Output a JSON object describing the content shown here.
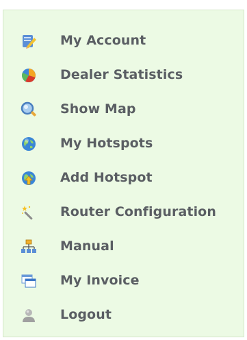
{
  "menu": {
    "items": [
      {
        "label": "My Account",
        "icon": "pencil-account-icon"
      },
      {
        "label": "Dealer Statistics",
        "icon": "pie-chart-icon"
      },
      {
        "label": "Show Map",
        "icon": "magnifier-icon"
      },
      {
        "label": "My Hotspots",
        "icon": "globe-icon"
      },
      {
        "label": "Add Hotspot",
        "icon": "globe-add-icon"
      },
      {
        "label": "Router Configuration",
        "icon": "magic-wand-icon"
      },
      {
        "label": "Manual",
        "icon": "sitemap-icon"
      },
      {
        "label": "My Invoice",
        "icon": "windows-icon"
      },
      {
        "label": "Logout",
        "icon": "user-silhouette-icon"
      }
    ]
  },
  "colors": {
    "panel_background": "#ecfae4",
    "panel_border": "#d4e6c8",
    "label_text": "#5a5e63"
  }
}
